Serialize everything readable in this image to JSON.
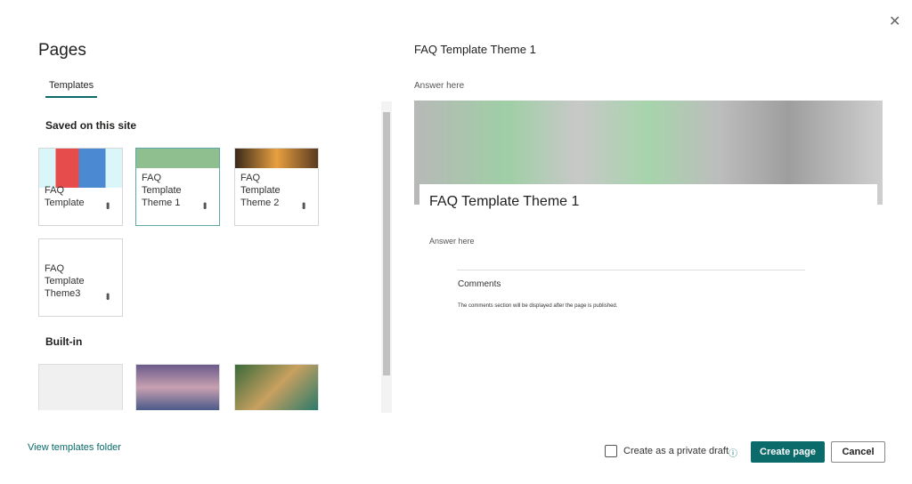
{
  "dialog": {
    "title": "Pages",
    "close_icon": "close-icon"
  },
  "tabs": [
    {
      "label": "Templates",
      "active": true
    }
  ],
  "sections": {
    "saved": "Saved on this site",
    "builtin": "Built-in"
  },
  "saved_templates": [
    {
      "label": "FAQ Template",
      "selected": false
    },
    {
      "label": "FAQ Template Theme 1",
      "selected": true
    },
    {
      "label": "FAQ Template Theme 2",
      "selected": false
    },
    {
      "label": "FAQ Template Theme3",
      "selected": false
    }
  ],
  "view_templates_link": "View templates folder",
  "preview": {
    "header": "FAQ Template Theme 1",
    "answer_top": "Answer here",
    "page_title": "FAQ Template Theme 1",
    "answer": "Answer here",
    "comments_heading": "Comments",
    "comments_note": "The comments section will be displayed after the page is published."
  },
  "footer": {
    "private_draft": "Create as a private draft",
    "create": "Create page",
    "cancel": "Cancel"
  },
  "colors": {
    "accent": "#0b6a6a"
  }
}
